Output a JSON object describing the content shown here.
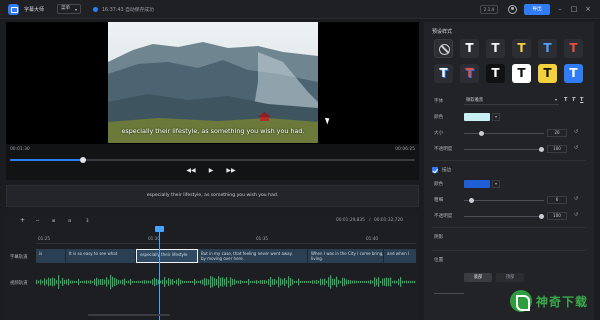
{
  "titlebar": {
    "app_name": "字幕大师",
    "menu_label": "菜单",
    "save_status": "16:37:43 自动保存成功",
    "version": "2.1.4",
    "export_label": "导出"
  },
  "preview": {
    "subtitle_overlay": "especially their lifestyle, as something you wish you had.",
    "current_time": "00:01:30",
    "total_time": "00:06:25",
    "progress": 0.18
  },
  "subtitle_strip": {
    "text": "especially their lifestyle, as something you wish you had."
  },
  "timeline": {
    "tools": [
      "+",
      "ꟷ",
      "⊞",
      "⊟",
      "3"
    ],
    "time_display": "00:01:29,835",
    "time_separator": "/",
    "total_display": "00:01:32,720",
    "ruler_ticks": [
      "01:25",
      "01:30",
      "01:35",
      "01:40"
    ],
    "subtitle_track_label": "字幕轨道",
    "audio_track_label": "视频轨道",
    "clips": [
      {
        "text": "is",
        "active": false
      },
      {
        "text": "It is so easy to see what",
        "active": false
      },
      {
        "text": "especially their lifestyle",
        "active": true
      },
      {
        "text": "But in my case, that feeling never went away.",
        "active": false
      },
      {
        "text": "When I was in the City I come bring,",
        "active": false
      },
      {
        "text": "and when I",
        "active": false
      }
    ],
    "clip_line2": [
      "",
      "",
      "",
      "by moving over here.",
      "living.",
      ""
    ]
  },
  "right_panel": {
    "preset_title": "预设样式",
    "presets": [
      {
        "kind": "none",
        "glyph": "",
        "bg": "#2c2e33",
        "color": "#c9ccd2"
      },
      {
        "kind": "text",
        "glyph": "T",
        "bg": "#2c2e33",
        "color": "#ffffff"
      },
      {
        "kind": "text",
        "glyph": "T",
        "bg": "#2c2e33",
        "color": "#f2f2f2"
      },
      {
        "kind": "text",
        "glyph": "T",
        "bg": "#2c2e33",
        "color": "#f4d03f"
      },
      {
        "kind": "text",
        "glyph": "T",
        "bg": "#2c2e33",
        "color": "#4da3ff"
      },
      {
        "kind": "text",
        "glyph": "T",
        "bg": "#2c2e33",
        "color": "#e74c3c"
      },
      {
        "kind": "text",
        "glyph": "T",
        "bg": "#2c2e33",
        "color": "#ffffff"
      },
      {
        "kind": "text",
        "glyph": "T",
        "bg": "#2c2e33",
        "color": "#e74c3c"
      },
      {
        "kind": "text",
        "glyph": "T",
        "bg": "#111111",
        "color": "#ffffff"
      },
      {
        "kind": "text",
        "glyph": "T",
        "bg": "#ffffff",
        "color": "#111111"
      },
      {
        "kind": "text",
        "glyph": "T",
        "bg": "#f4d03f",
        "color": "#111111"
      },
      {
        "kind": "text",
        "glyph": "T",
        "bg": "#2f7cf6",
        "color": "#ffffff"
      }
    ],
    "font_label": "字体",
    "font_value": "微软雅黑",
    "color_label": "颜色",
    "text_color": "#c8f0f2",
    "size_label": "大小",
    "size_value": "20",
    "size_level": 0.2,
    "opacity_label": "不透明度",
    "opacity_value": "100",
    "opacity_level": 1.0,
    "stroke_label": "描边",
    "stroke_color_label": "颜色",
    "stroke_color": "#1f5fd6",
    "thickness_label": "粗细",
    "thickness_value": "6",
    "thickness_level": 0.06,
    "stroke_opacity_label": "不透明度",
    "stroke_opacity_value": "100",
    "stroke_opacity_level": 1.0,
    "shadow_label": "阴影",
    "position_label": "位置",
    "position_tabs": [
      "底部",
      "顶部"
    ]
  },
  "watermark": {
    "text": "神奇下载"
  },
  "colors": {
    "accent": "#2f7cf6",
    "background": "#1b1c1f"
  }
}
